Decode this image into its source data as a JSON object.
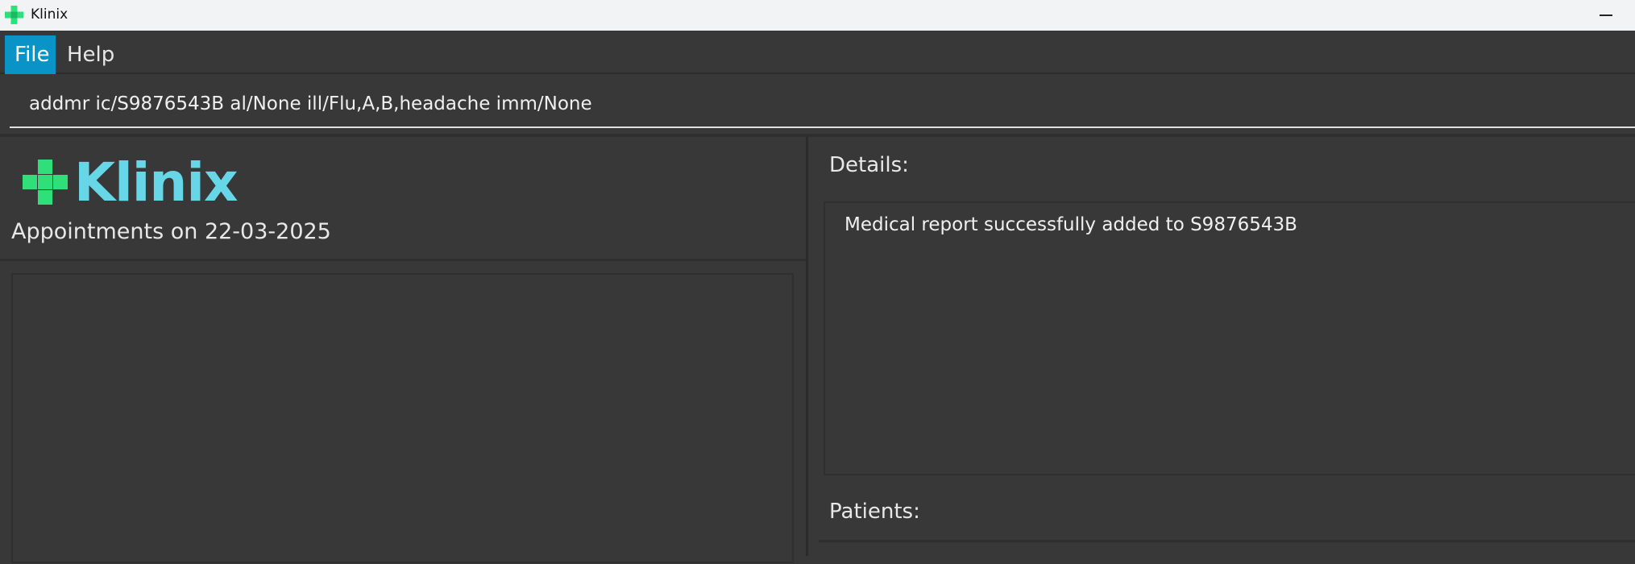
{
  "window": {
    "title": "Klinix",
    "icon": "green-cross-icon"
  },
  "colors": {
    "background": "#383838",
    "accent_menu": "#0a93c6",
    "logo_cross": "#2fe07a",
    "logo_text": "#67d7e8"
  },
  "menu": {
    "items": [
      {
        "label": "File"
      },
      {
        "label": "Help"
      }
    ]
  },
  "command": {
    "value": "addmr ic/S9876543B al/None ill/Flu,A,B,headache imm/None"
  },
  "left": {
    "logo_text": "Klinix",
    "appointments_title": "Appointments on 22-03-2025"
  },
  "right": {
    "details_label": "Details:",
    "details_message": "Medical report successfully added to S9876543B",
    "patients_label": "Patients:"
  }
}
